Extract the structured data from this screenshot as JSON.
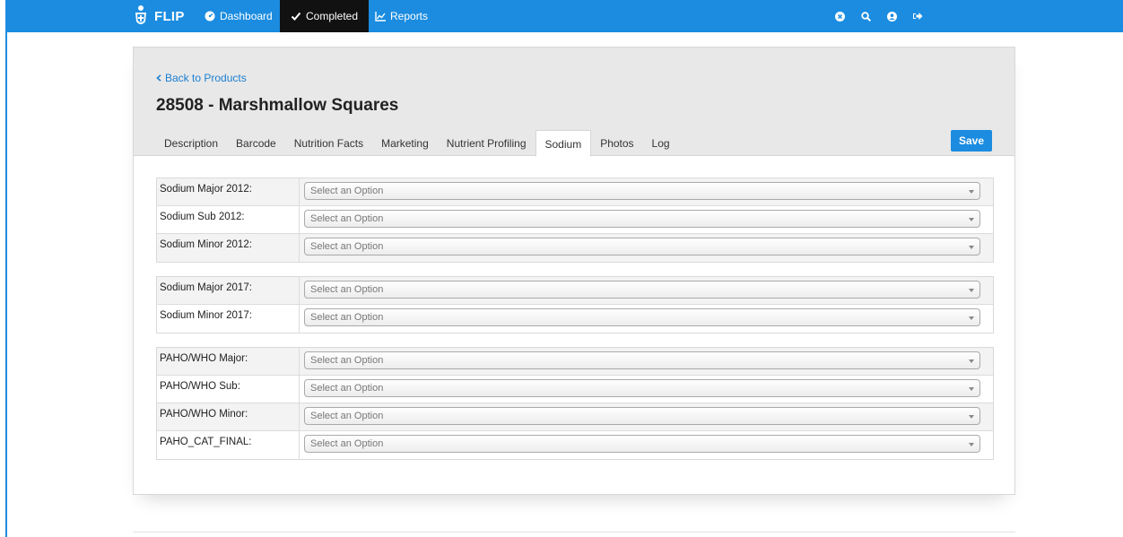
{
  "nav": {
    "brand": "FLIP",
    "items": [
      {
        "label": "Dashboard",
        "icon": "dashboard-icon"
      },
      {
        "label": "Completed",
        "icon": "check-icon"
      },
      {
        "label": "Reports",
        "icon": "chart-icon"
      }
    ],
    "right_icons": [
      "close-circle-icon",
      "search-icon",
      "user-icon",
      "logout-icon"
    ],
    "color": "#1b8ce0"
  },
  "header": {
    "back_link": "Back to Products",
    "title": "28508 - Marshmallow Squares",
    "tabs": [
      "Description",
      "Barcode",
      "Nutrition Facts",
      "Marketing",
      "Nutrient Profiling",
      "Sodium",
      "Photos",
      "Log"
    ],
    "active_tab": "Sodium",
    "save_label": "Save"
  },
  "groups": [
    {
      "rows": [
        {
          "label": "Sodium Major 2012:",
          "placeholder": "Select an Option"
        },
        {
          "label": "Sodium Sub 2012:",
          "placeholder": "Select an Option"
        },
        {
          "label": "Sodium Minor 2012:",
          "placeholder": "Select an Option"
        }
      ]
    },
    {
      "rows": [
        {
          "label": "Sodium Major 2017:",
          "placeholder": "Select an Option"
        },
        {
          "label": "Sodium Minor 2017:",
          "placeholder": "Select an Option"
        }
      ]
    },
    {
      "rows": [
        {
          "label": "PAHO/WHO Major:",
          "placeholder": "Select an Option"
        },
        {
          "label": "PAHO/WHO Sub:",
          "placeholder": "Select an Option"
        },
        {
          "label": "PAHO/WHO Minor:",
          "placeholder": "Select an Option"
        },
        {
          "label": "PAHO_CAT_FINAL:",
          "placeholder": "Select an Option"
        }
      ]
    }
  ]
}
